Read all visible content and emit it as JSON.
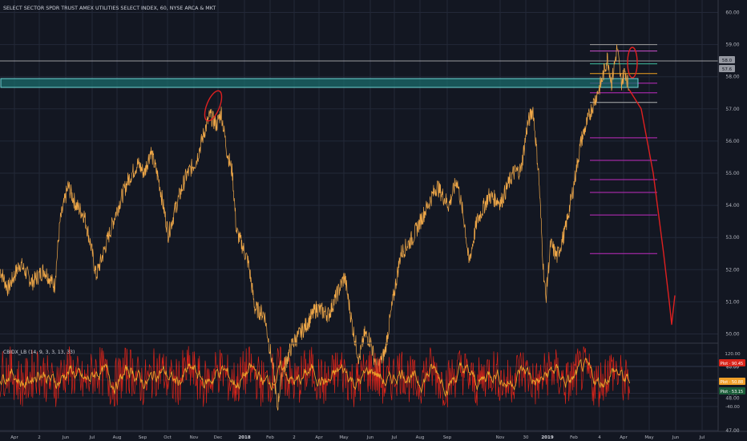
{
  "header": {
    "title": "SELECT SECTOR SPDR TRUST AMEX UTILITIES SELECT INDEX, 60, NYSE ARCA & MKT"
  },
  "colors": {
    "background": "#131722",
    "grid": "#232838",
    "price_line": "#f0a848",
    "zone_fill": "#1b6b6b",
    "zone_stroke": "#6fd6d6",
    "drawing_red": "#e02020",
    "fib_magenta": "#c02cc0",
    "osc_red": "#d9241a",
    "osc_orange": "#f0a02a",
    "axis_text": "#b2b5be"
  },
  "x_axis": {
    "labels": [
      "Apr",
      "2",
      "Jun",
      "Jul",
      "Aug",
      "Sep",
      "Oct",
      "Nov",
      "Dec",
      "2018",
      "Feb",
      "2",
      "Apr",
      "May",
      "Jun",
      "Jul",
      "Aug",
      "Sep",
      "Nov",
      "30",
      "2019",
      "Feb",
      "4",
      "Apr",
      "May",
      "Jun",
      "Jul"
    ]
  },
  "price_axis": {
    "ticks": [
      "60.00",
      "59.00",
      "58.00",
      "57.00",
      "56.00",
      "55.00",
      "54.00",
      "53.00",
      "52.00",
      "51.00",
      "50.00",
      "49.00",
      "48.00",
      "47.00"
    ],
    "badges": [
      {
        "text": "58.0",
        "color": "#9598a1"
      },
      {
        "text": "57.6",
        "color": "#9598a1"
      }
    ]
  },
  "chart_data": {
    "type": "line",
    "title": "SELECT SECTOR SPDR TRUST AMEX UTILITIES SELECT INDEX, 60, NYSE ARCA & MKT",
    "ylim": [
      46.4,
      60.2
    ],
    "x_ticks": [
      "Apr",
      "2",
      "Jun",
      "Jul",
      "Aug",
      "Sep",
      "Oct",
      "Nov",
      "Dec",
      "2018",
      "Feb",
      "2",
      "Apr",
      "May",
      "Jun",
      "Jul",
      "Aug",
      "Sep",
      "Nov",
      "30",
      "2019",
      "Feb",
      "4",
      "Apr",
      "May",
      "Jun",
      "Jul"
    ],
    "series": [
      {
        "anchor_points": [
          [
            0,
            52.0
          ],
          [
            10,
            51.4
          ],
          [
            25,
            52.2
          ],
          [
            40,
            51.6
          ],
          [
            55,
            52.0
          ],
          [
            68,
            51.5
          ],
          [
            75,
            53.5
          ],
          [
            85,
            54.6
          ],
          [
            95,
            54.0
          ],
          [
            105,
            53.7
          ],
          [
            113,
            52.8
          ],
          [
            120,
            51.8
          ],
          [
            130,
            52.6
          ],
          [
            145,
            53.8
          ],
          [
            160,
            54.8
          ],
          [
            172,
            55.3
          ],
          [
            180,
            55.0
          ],
          [
            188,
            55.7
          ],
          [
            198,
            54.8
          ],
          [
            210,
            53.1
          ],
          [
            220,
            54.0
          ],
          [
            232,
            54.9
          ],
          [
            245,
            55.4
          ],
          [
            255,
            56.3
          ],
          [
            262,
            56.8
          ],
          [
            270,
            56.5
          ],
          [
            276,
            56.9
          ],
          [
            283,
            55.7
          ],
          [
            290,
            55.0
          ],
          [
            295,
            53.2
          ],
          [
            303,
            52.7
          ],
          [
            310,
            52.2
          ],
          [
            318,
            50.8
          ],
          [
            330,
            50.6
          ],
          [
            342,
            48.7
          ],
          [
            346,
            47.7
          ],
          [
            352,
            48.8
          ],
          [
            365,
            49.7
          ],
          [
            380,
            50.2
          ],
          [
            395,
            50.8
          ],
          [
            410,
            50.6
          ],
          [
            420,
            51.2
          ],
          [
            430,
            51.8
          ],
          [
            440,
            50.2
          ],
          [
            448,
            49.2
          ],
          [
            455,
            50.0
          ],
          [
            462,
            49.8
          ],
          [
            470,
            48.9
          ],
          [
            480,
            49.4
          ],
          [
            490,
            51.0
          ],
          [
            500,
            52.5
          ],
          [
            515,
            53.0
          ],
          [
            530,
            53.8
          ],
          [
            545,
            54.6
          ],
          [
            560,
            54.0
          ],
          [
            570,
            54.8
          ],
          [
            580,
            53.4
          ],
          [
            585,
            52.2
          ],
          [
            595,
            53.5
          ],
          [
            610,
            54.3
          ],
          [
            625,
            54.1
          ],
          [
            640,
            55.0
          ],
          [
            650,
            55.1
          ],
          [
            658,
            56.5
          ],
          [
            665,
            57.0
          ],
          [
            672,
            55.0
          ],
          [
            678,
            52.0
          ],
          [
            681,
            51.1
          ],
          [
            687,
            52.8
          ],
          [
            695,
            52.4
          ],
          [
            705,
            53.2
          ],
          [
            715,
            54.5
          ],
          [
            725,
            56.0
          ],
          [
            738,
            57.0
          ],
          [
            750,
            57.8
          ],
          [
            758,
            58.6
          ],
          [
            763,
            57.8
          ],
          [
            770,
            58.9
          ],
          [
            775,
            57.8
          ],
          [
            780,
            58.2
          ],
          [
            785,
            57.6
          ]
        ]
      }
    ],
    "resistance_zone": {
      "low": 56.8,
      "high": 57.0
    },
    "fib_levels": [
      59.0,
      58.8,
      58.4,
      58.1,
      57.8,
      57.5,
      57.2,
      56.1,
      55.4,
      54.8,
      54.4,
      53.7,
      52.5
    ],
    "projection_path": [
      [
        785,
        57.6
      ],
      [
        800,
        57.0
      ],
      [
        815,
        55.0
      ],
      [
        828,
        52.5
      ],
      [
        835,
        51.0
      ],
      [
        838,
        50.3
      ],
      [
        842,
        51.2
      ]
    ],
    "oscillator": {
      "label": "CBIDX_LB (14, 9, 3, 3, 13, 33)",
      "ticks": [
        "120.00",
        "80.00",
        "40.00",
        "0.00",
        "-40.00"
      ],
      "ylim": [
        -60,
        140
      ],
      "readouts": [
        {
          "text": "Plot · 90.45",
          "color": "#d9241a"
        },
        {
          "text": "Plot · 50.88",
          "color": "#f0a02a"
        },
        {
          "text": "Plot · 53.15",
          "color": "#1b5e3a"
        }
      ]
    }
  }
}
